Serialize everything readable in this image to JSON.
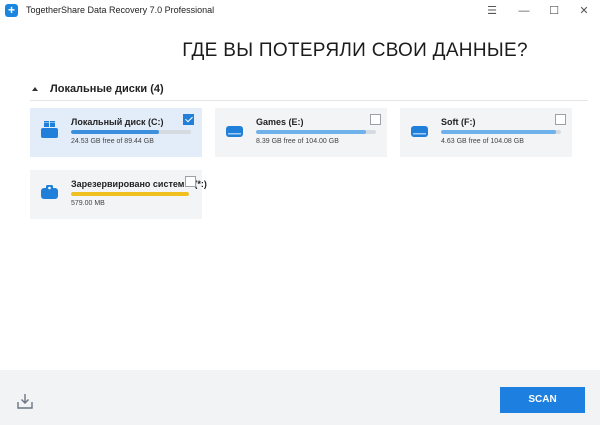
{
  "window": {
    "title": "TogetherShare Data Recovery 7.0 Professional",
    "minimize": "—",
    "maximize": "☐",
    "close": "✕",
    "menu": "☰"
  },
  "heading": "ГДЕ ВЫ ПОТЕРЯЛИ СВОИ ДАННЫЕ?",
  "section": {
    "title": "Локальные диски (4)"
  },
  "drives": [
    {
      "name": "Локальный диск (C:)",
      "info": "24.53 GB free of 89.44 GB",
      "used_fraction": 0.73,
      "bar_color": "#3b8fdc",
      "checked": true
    },
    {
      "name": "Games (E:)",
      "info": "8.39 GB free of 104.00 GB",
      "used_fraction": 0.92,
      "bar_color": "#6fb1ea",
      "checked": false
    },
    {
      "name": "Soft (F:)",
      "info": "4.63 GB free of 104.08 GB",
      "used_fraction": 0.955,
      "bar_color": "#6fb1ea",
      "checked": false
    },
    {
      "name": "Зарезервировано систем... (*:)",
      "info": "579.00 MB",
      "used_fraction": 1.0,
      "bar_color": "#f0c020",
      "checked": false
    }
  ],
  "footer": {
    "scan_label": "SCAN"
  },
  "colors": {
    "accent": "#1d7fe0",
    "drive_icon": "#1f7fd9"
  }
}
